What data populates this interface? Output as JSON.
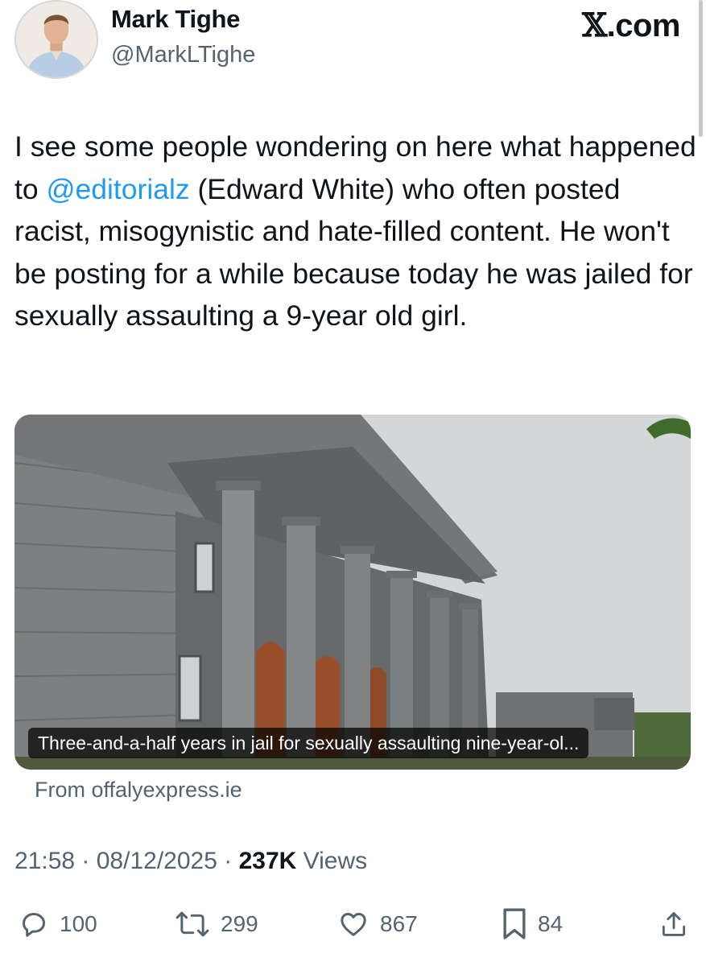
{
  "author": {
    "display_name": "Mark Tighe",
    "handle": "@MarkLTighe"
  },
  "platform": {
    "logo_icon": "x-logo-icon",
    "logo_text": ".com"
  },
  "tweet": {
    "text_before_mention": "I see some people wondering on here what happened to ",
    "mention": "@editorialz",
    "text_after_mention": " (Edward White) who often posted racist, misogynistic and hate-filled content. He won't be posting for a while because today he was jailed for sexually assaulting a 9-year old girl."
  },
  "link_card": {
    "caption": "Three-and-a-half years in jail for sexually assaulting nine-year-ol...",
    "source": "From offalyexpress.ie"
  },
  "meta": {
    "time": "21:58",
    "sep1": " · ",
    "date": "08/12/2025",
    "sep2": " · ",
    "views_count": "237K",
    "views_label": " Views"
  },
  "actions": {
    "replies": "100",
    "reposts": "299",
    "likes": "867",
    "bookmarks": "84"
  },
  "colors": {
    "link_blue": "#1d9bf0",
    "secondary_text": "#536471",
    "primary_text": "#0f1419"
  }
}
